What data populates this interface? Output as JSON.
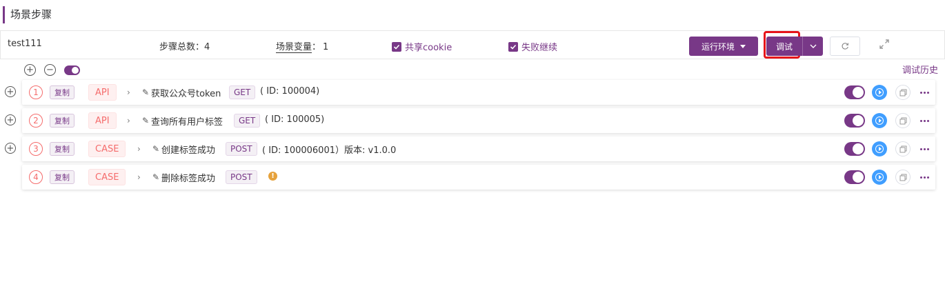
{
  "page": {
    "title": "场景步骤"
  },
  "header": {
    "scenario_name": "test111",
    "steps_label": "步骤总数：",
    "steps_count": "4",
    "vars_label": "场景变量",
    "vars_colon": "：",
    "vars_count": "1",
    "share_cookie_label": "共享cookie",
    "share_cookie_checked": true,
    "fail_continue_label": "失败继续",
    "fail_continue_checked": true,
    "env_button_label": "运行环境",
    "debug_button_label": "调试"
  },
  "tools": {
    "expand_all_icon": "plus-circle-icon",
    "collapse_all_icon": "minus-circle-icon",
    "enable_toggle": true
  },
  "debug_history_label": "调试历史",
  "steps": [
    {
      "index": "1",
      "copy_label": "复制",
      "type": "API",
      "name": "获取公众号token",
      "method": "GET",
      "info": "( ID: 100004)",
      "enabled": true,
      "warn": false
    },
    {
      "index": "2",
      "copy_label": "复制",
      "type": "API",
      "name": "查询所有用户标签",
      "method": "GET",
      "info": "( ID: 100005)",
      "enabled": true,
      "warn": false
    },
    {
      "index": "3",
      "copy_label": "复制",
      "type": "CASE",
      "name": "创建标签成功",
      "method": "POST",
      "info": "( ID: 100006001）版本: v1.0.0",
      "enabled": true,
      "warn": false
    },
    {
      "index": "4",
      "copy_label": "复制",
      "type": "CASE",
      "name": "删除标签成功",
      "method": "POST",
      "info": "",
      "enabled": true,
      "warn": true
    }
  ],
  "colors": {
    "accent": "#783887",
    "danger": "#f56c6c",
    "run": "#409eff",
    "warning": "#e6a23c",
    "highlight": "#e6131a"
  }
}
